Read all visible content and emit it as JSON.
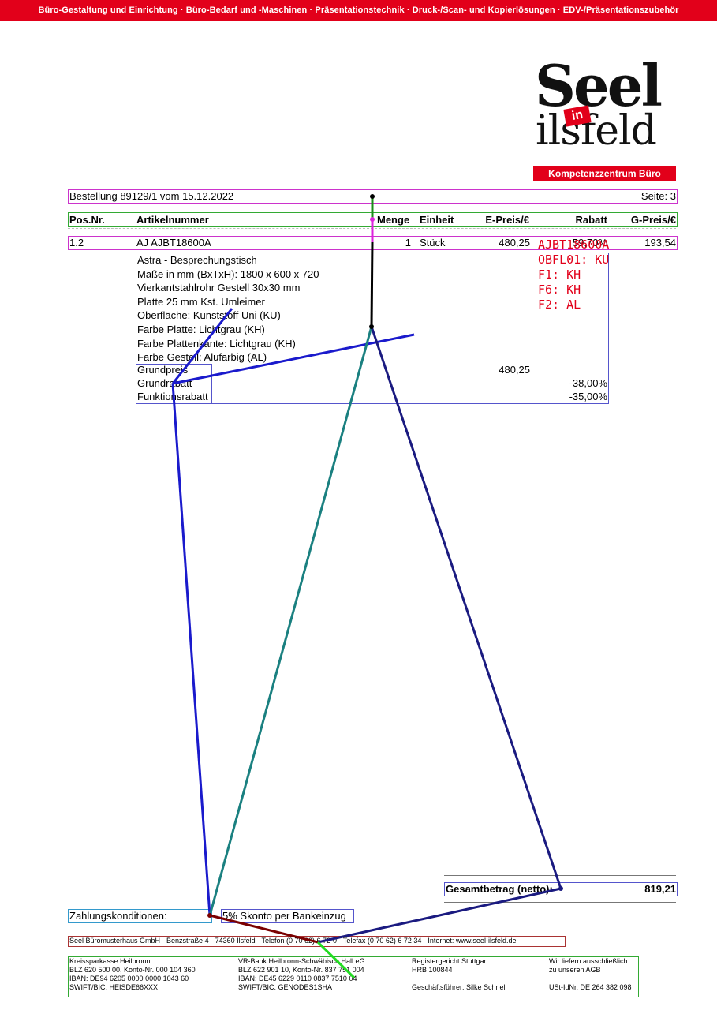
{
  "top_bar": "Büro-Gestaltung und Einrichtung · Büro-Bedarf und -Maschinen · Präsentationstechnik · Druck-/Scan- und Kopierlösungen · EDV-/Präsentationszubehör",
  "logo": {
    "word1": "Seel",
    "badge": "in",
    "word2": "ilsfeld",
    "band": "Kompetenzzentrum Büro"
  },
  "order_header": {
    "title": "Bestellung 89129/1 vom 15.12.2022",
    "page": "Seite: 3"
  },
  "columns": [
    "Pos.Nr.",
    "Artikelnummer",
    "Menge",
    "Einheit",
    "E-Preis/€",
    "Rabatt",
    "G-Preis/€"
  ],
  "item": {
    "pos": "1.2",
    "article": "AJ AJBT18600A",
    "qty": "1",
    "unit": "Stück",
    "unit_price": "480,25",
    "discount": "59,70%",
    "total": "193,54",
    "description": [
      "Astra - Besprechungstisch",
      "Maße in mm (BxTxH): 1800 x 600 x 720",
      "Vierkantstahlrohr Gestell 30x30 mm",
      "Platte 25 mm Kst. Umleimer",
      "Oberfläche: Kunststoff Uni (KU)",
      "Farbe Platte: Lichtgrau (KH)",
      "Farbe Plattenkante: Lichtgrau (KH)",
      "Farbe Gestell: Alufarbig (AL)"
    ],
    "codes": [
      "AJBT18600A",
      "OBFL01: KU",
      "F1: KH",
      "F6: KH",
      "F2: AL"
    ],
    "pricing": [
      {
        "label": "Grundpreis",
        "price": "480,25",
        "pct": ""
      },
      {
        "label": "Grundrabatt",
        "price": "",
        "pct": "-38,00%"
      },
      {
        "label": "Funktionsrabatt",
        "price": "",
        "pct": "-35,00%"
      }
    ]
  },
  "total": {
    "label": "Gesamtbetrag (netto):",
    "value": "819,21"
  },
  "payment": {
    "label": "Zahlungskonditionen:",
    "value": "5% Skonto per Bankeinzug"
  },
  "footer": {
    "address": "Seel Büromusterhaus GmbH  ·  Benzstraße 4  ·  74360 Ilsfeld  ·  Telefon (0 70 62) 6 72-0  ·  Telefax (0 70 62) 6 72 34  ·  Internet: www.seel-ilsfeld.de",
    "cols": [
      [
        "Kreissparkasse Heilbronn",
        "BLZ 620 500 00, Konto-Nr. 000 104 360",
        "IBAN: DE94 6205 0000 0000 1043 60",
        "SWIFT/BIC: HEISDE66XXX"
      ],
      [
        "VR-Bank Heilbronn-Schwäbisch Hall eG",
        "BLZ 622 901 10, Konto-Nr. 837 751 004",
        "IBAN: DE45 6229 0110 0837 7510 04",
        "SWIFT/BIC: GENODES1SHA"
      ],
      [
        "Registergericht Stuttgart",
        "HRB 100844",
        "",
        "Geschäftsführer: Silke Schnell"
      ],
      [
        "Wir liefern ausschließlich",
        "zu unseren AGB",
        "",
        "USt-IdNr. DE 264 382 098"
      ]
    ]
  },
  "overlay_colors": {
    "green": "#1a8c1a",
    "magenta": "#dd22dd",
    "black": "#000000",
    "blue": "#1a1acc",
    "teal": "#1a8080",
    "navy": "#1a1a80",
    "darkred": "#7a0000",
    "lime": "#22dd22"
  }
}
